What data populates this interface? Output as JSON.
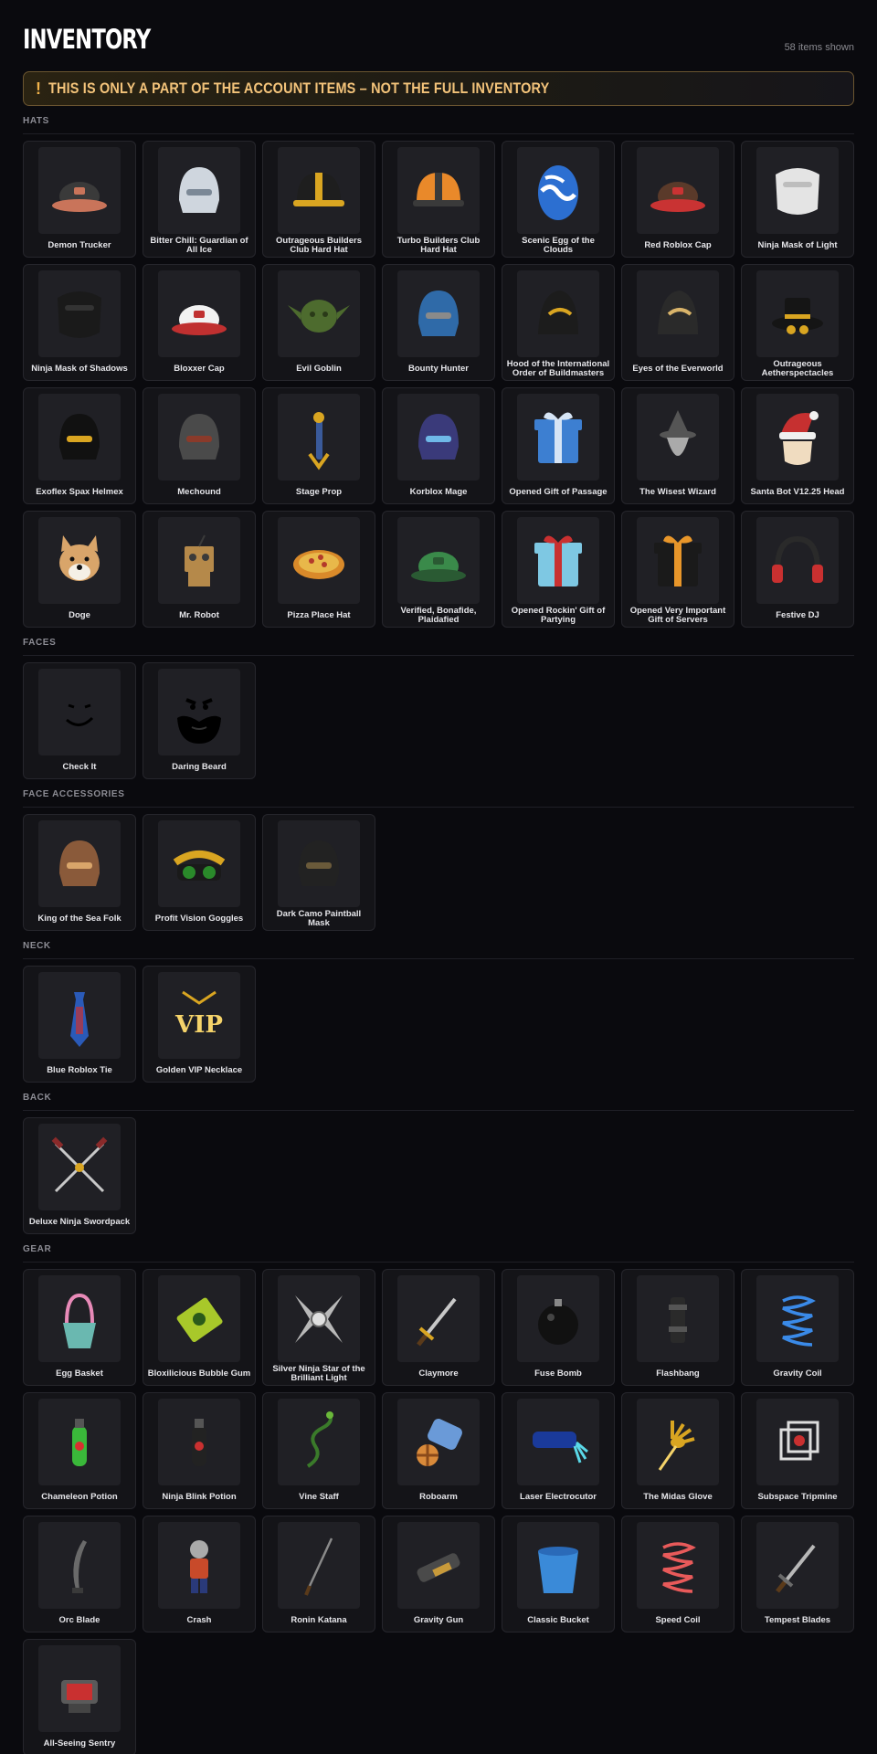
{
  "header": {
    "title": "INVENTORY",
    "count": "58 items shown"
  },
  "banner": {
    "icon": "!",
    "text": "THIS IS ONLY A PART OF THE ACCOUNT ITEMS – NOT THE FULL INVENTORY"
  },
  "sections": [
    {
      "title": "HATS",
      "items": [
        {
          "label": "Demon Trucker",
          "icon": "demon-trucker-icon",
          "shape": "cap",
          "color": "#3a3a3a",
          "accent": "#c9745a"
        },
        {
          "label": "Bitter Chill: Guardian of All Ice",
          "icon": "ice-guardian-icon",
          "shape": "helm",
          "color": "#cfd6de",
          "accent": "#7b8896"
        },
        {
          "label": "Outrageous Builders Club Hard Hat",
          "icon": "hard-hat-icon",
          "shape": "hardhat",
          "color": "#1e1e1e",
          "accent": "#d9a521"
        },
        {
          "label": "Turbo Builders Club Hard Hat",
          "icon": "hard-hat-icon",
          "shape": "hardhat",
          "color": "#e9892a",
          "accent": "#3a3a3a"
        },
        {
          "label": "Scenic Egg of the Clouds",
          "icon": "egg-icon",
          "shape": "egg",
          "color": "#2c6fd1",
          "accent": "#ffffff"
        },
        {
          "label": "Red Roblox Cap",
          "icon": "cap-icon",
          "shape": "cap",
          "color": "#5a3a2a",
          "accent": "#c93333"
        },
        {
          "label": "Ninja Mask of Light",
          "icon": "mask-icon",
          "shape": "mask",
          "color": "#e4e4e4",
          "accent": "#bdbdbd"
        },
        {
          "label": "Ninja Mask of Shadows",
          "icon": "mask-icon",
          "shape": "mask",
          "color": "#1a1a1a",
          "accent": "#333333"
        },
        {
          "label": "Bloxxer Cap",
          "icon": "cap-icon",
          "shape": "cap",
          "color": "#f2f2f2",
          "accent": "#c03030"
        },
        {
          "label": "Evil Goblin",
          "icon": "goblin-icon",
          "shape": "head",
          "color": "#4d6b2e",
          "accent": "#2a3a18"
        },
        {
          "label": "Bounty Hunter",
          "icon": "helmet-icon",
          "shape": "helm",
          "color": "#2f6aa8",
          "accent": "#8a8a8a"
        },
        {
          "label": "Hood of the International Order of Buildmasters",
          "icon": "hood-icon",
          "shape": "hood",
          "color": "#1c1c1c",
          "accent": "#d9a521"
        },
        {
          "label": "Eyes of the Everworld",
          "icon": "eyes-icon",
          "shape": "hood",
          "color": "#2a2a2a",
          "accent": "#d9b46a"
        },
        {
          "label": "Outrageous Aetherspectacles",
          "icon": "top-hat-icon",
          "shape": "tophat",
          "color": "#151515",
          "accent": "#d9a521"
        },
        {
          "label": "Exoflex Spax Helmex",
          "icon": "helmet-icon",
          "shape": "helm",
          "color": "#111111",
          "accent": "#d9a521"
        },
        {
          "label": "Mechound",
          "icon": "mech-head-icon",
          "shape": "helm",
          "color": "#4a4a4a",
          "accent": "#8a3a2a"
        },
        {
          "label": "Stage Prop",
          "icon": "prop-icon",
          "shape": "staff",
          "color": "#3a5a9a",
          "accent": "#d9a521"
        },
        {
          "label": "Korblox Mage",
          "icon": "mage-icon",
          "shape": "helm",
          "color": "#3a3a7a",
          "accent": "#6fb8e8"
        },
        {
          "label": "Opened Gift of Passage",
          "icon": "gift-icon",
          "shape": "gift",
          "color": "#3d7fd1",
          "accent": "#d6e4f5"
        },
        {
          "label": "The Wisest Wizard",
          "icon": "wizard-icon",
          "shape": "wizard",
          "color": "#555555",
          "accent": "#aaaaaa"
        },
        {
          "label": "Santa Bot V12.25 Head",
          "icon": "santa-icon",
          "shape": "santa",
          "color": "#c63030",
          "accent": "#f0dcc0"
        },
        {
          "label": "Doge",
          "icon": "doge-icon",
          "shape": "doge",
          "color": "#d9a56a",
          "accent": "#f5f0e6"
        },
        {
          "label": "Mr. Robot",
          "icon": "robot-icon",
          "shape": "robot",
          "color": "#b5894a",
          "accent": "#3a3a3a"
        },
        {
          "label": "Pizza Place Hat",
          "icon": "pizza-icon",
          "shape": "pizza",
          "color": "#d98a2a",
          "accent": "#b33a2a"
        },
        {
          "label": "Verified, Bonafide, Plaidafied",
          "icon": "plaid-cap-icon",
          "shape": "cap",
          "color": "#3a8a4a",
          "accent": "#2a5a33"
        },
        {
          "label": "Opened Rockin' Gift of Partying",
          "icon": "gift-icon",
          "shape": "gift",
          "color": "#7ec8e3",
          "accent": "#c93030"
        },
        {
          "label": "Opened Very Important Gift of Servers",
          "icon": "gift-icon",
          "shape": "gift",
          "color": "#1a1a1a",
          "accent": "#e8962a"
        },
        {
          "label": "Festive DJ",
          "icon": "headphones-icon",
          "shape": "headphones",
          "color": "#2a2a2a",
          "accent": "#c93030"
        }
      ]
    },
    {
      "title": "FACES",
      "items": [
        {
          "label": "Check It",
          "icon": "smile-face-icon",
          "shape": "face",
          "color": "#000000",
          "accent": "#000000"
        },
        {
          "label": "Daring Beard",
          "icon": "beard-face-icon",
          "shape": "beard",
          "color": "#000000",
          "accent": "#000000"
        }
      ]
    },
    {
      "title": "FACE ACCESSORIES",
      "items": [
        {
          "label": "King of the Sea Folk",
          "icon": "sea-king-icon",
          "shape": "helm",
          "color": "#8a5a3a",
          "accent": "#d9a56a"
        },
        {
          "label": "Profit Vision Goggles",
          "icon": "goggles-icon",
          "shape": "goggles",
          "color": "#1a1a1a",
          "accent": "#d9a521"
        },
        {
          "label": "Dark Camo Paintball Mask",
          "icon": "paintball-mask-icon",
          "shape": "helm",
          "color": "#222222",
          "accent": "#6a5a3a"
        }
      ]
    },
    {
      "title": "NECK",
      "items": [
        {
          "label": "Blue Roblox Tie",
          "icon": "tie-icon",
          "shape": "tie",
          "color": "#2a5ab8",
          "accent": "#c93030"
        },
        {
          "label": "Golden VIP Necklace",
          "icon": "necklace-icon",
          "shape": "vip",
          "color": "#d9a521",
          "accent": "#f5d36a"
        }
      ]
    },
    {
      "title": "BACK",
      "items": [
        {
          "label": "Deluxe Ninja Swordpack",
          "icon": "swords-icon",
          "shape": "swords",
          "color": "#8a2a2a",
          "accent": "#d9a521"
        }
      ]
    },
    {
      "title": "GEAR",
      "items": [
        {
          "label": "Egg Basket",
          "icon": "basket-icon",
          "shape": "basket",
          "color": "#6ab8b0",
          "accent": "#e88ab8"
        },
        {
          "label": "Bloxilicious Bubble Gum",
          "icon": "gum-icon",
          "shape": "gum",
          "color": "#a8c82a",
          "accent": "#2a5a1a"
        },
        {
          "label": "Silver Ninja Star of the Brilliant Light",
          "icon": "ninja-star-icon",
          "shape": "star",
          "color": "#b8b8b8",
          "accent": "#e0e0e0"
        },
        {
          "label": "Claymore",
          "icon": "sword-icon",
          "shape": "sword",
          "color": "#c8c8c8",
          "accent": "#d9a521"
        },
        {
          "label": "Fuse Bomb",
          "icon": "bomb-icon",
          "shape": "bomb",
          "color": "#111111",
          "accent": "#888888"
        },
        {
          "label": "Flashbang",
          "icon": "flashbang-icon",
          "shape": "canister",
          "color": "#2a2a2a",
          "accent": "#555555"
        },
        {
          "label": "Gravity Coil",
          "icon": "coil-icon",
          "shape": "coil",
          "color": "#3a8ae8",
          "accent": "#3a8ae8"
        },
        {
          "label": "Chameleon Potion",
          "icon": "potion-icon",
          "shape": "potion",
          "color": "#3ab83a",
          "accent": "#d93030"
        },
        {
          "label": "Ninja Blink Potion",
          "icon": "potion-icon",
          "shape": "potion",
          "color": "#222222",
          "accent": "#c93030"
        },
        {
          "label": "Vine Staff",
          "icon": "staff-icon",
          "shape": "vine",
          "color": "#3a7a2a",
          "accent": "#6ab83a"
        },
        {
          "label": "Roboarm",
          "icon": "roboarm-icon",
          "shape": "roboarm",
          "color": "#6a9ad8",
          "accent": "#d98a3a"
        },
        {
          "label": "Laser Electrocutor",
          "icon": "laser-icon",
          "shape": "laser",
          "color": "#1a3a9a",
          "accent": "#5ad8e8"
        },
        {
          "label": "The Midas Glove",
          "icon": "glove-icon",
          "shape": "glove",
          "color": "#d9a521",
          "accent": "#f5d36a"
        },
        {
          "label": "Subspace Tripmine",
          "icon": "tripmine-icon",
          "shape": "cube",
          "color": "#dddddd",
          "accent": "#c93030"
        },
        {
          "label": "Orc Blade",
          "icon": "blade-icon",
          "shape": "blade",
          "color": "#6a6a6a",
          "accent": "#3a3a3a"
        },
        {
          "label": "Crash",
          "icon": "character-icon",
          "shape": "figure",
          "color": "#c84a2a",
          "accent": "#2a3a7a"
        },
        {
          "label": "Ronin Katana",
          "icon": "katana-icon",
          "shape": "katana",
          "color": "#8a8a8a",
          "accent": "#5a3a1a"
        },
        {
          "label": "Gravity Gun",
          "icon": "gun-icon",
          "shape": "gun",
          "color": "#4a4a4a",
          "accent": "#c89a3a"
        },
        {
          "label": "Classic Bucket",
          "icon": "bucket-icon",
          "shape": "bucket",
          "color": "#3a8ad8",
          "accent": "#2a6ab8"
        },
        {
          "label": "Speed Coil",
          "icon": "coil-icon",
          "shape": "coil",
          "color": "#e85a5a",
          "accent": "#e85a5a"
        },
        {
          "label": "Tempest Blades",
          "icon": "sword-icon",
          "shape": "sword",
          "color": "#b8b8b8",
          "accent": "#6a6a6a"
        },
        {
          "label": "All-Seeing Sentry",
          "icon": "sentry-icon",
          "shape": "sentry",
          "color": "#5a5a5a",
          "accent": "#c93030"
        }
      ]
    }
  ]
}
